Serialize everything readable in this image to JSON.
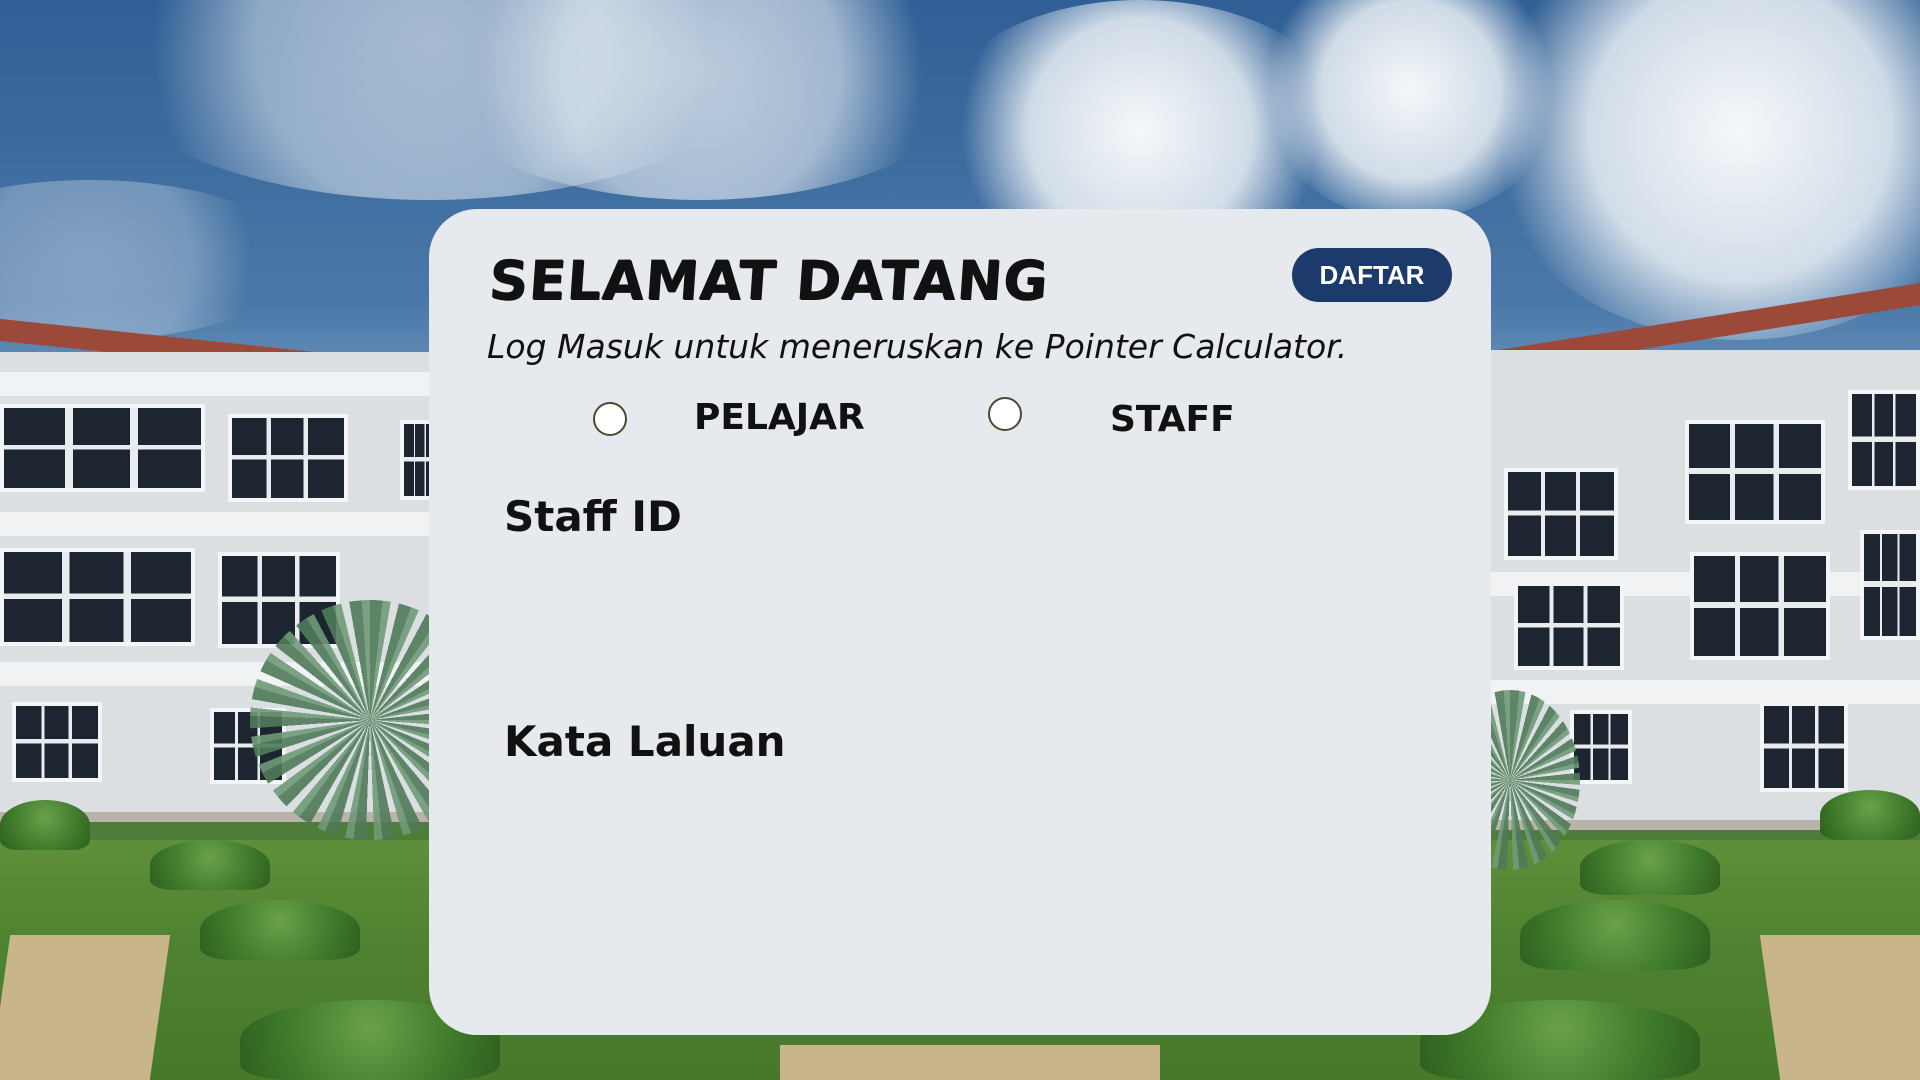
{
  "login": {
    "title": "SELAMAT DATANG",
    "register_button": "DAFTAR",
    "subtitle": "Log Masuk untuk meneruskan ke Pointer Calculator.",
    "role_options": [
      {
        "label": "PELAJAR",
        "selected": false
      },
      {
        "label": "STAFF",
        "selected": false
      }
    ],
    "fields": {
      "id_label": "Staff ID",
      "id_value": "",
      "password_label": "Kata Laluan",
      "password_value": ""
    }
  },
  "colors": {
    "card_background": "#e6e9ee",
    "register_button": "#1c3a6b",
    "text": "#111111"
  }
}
